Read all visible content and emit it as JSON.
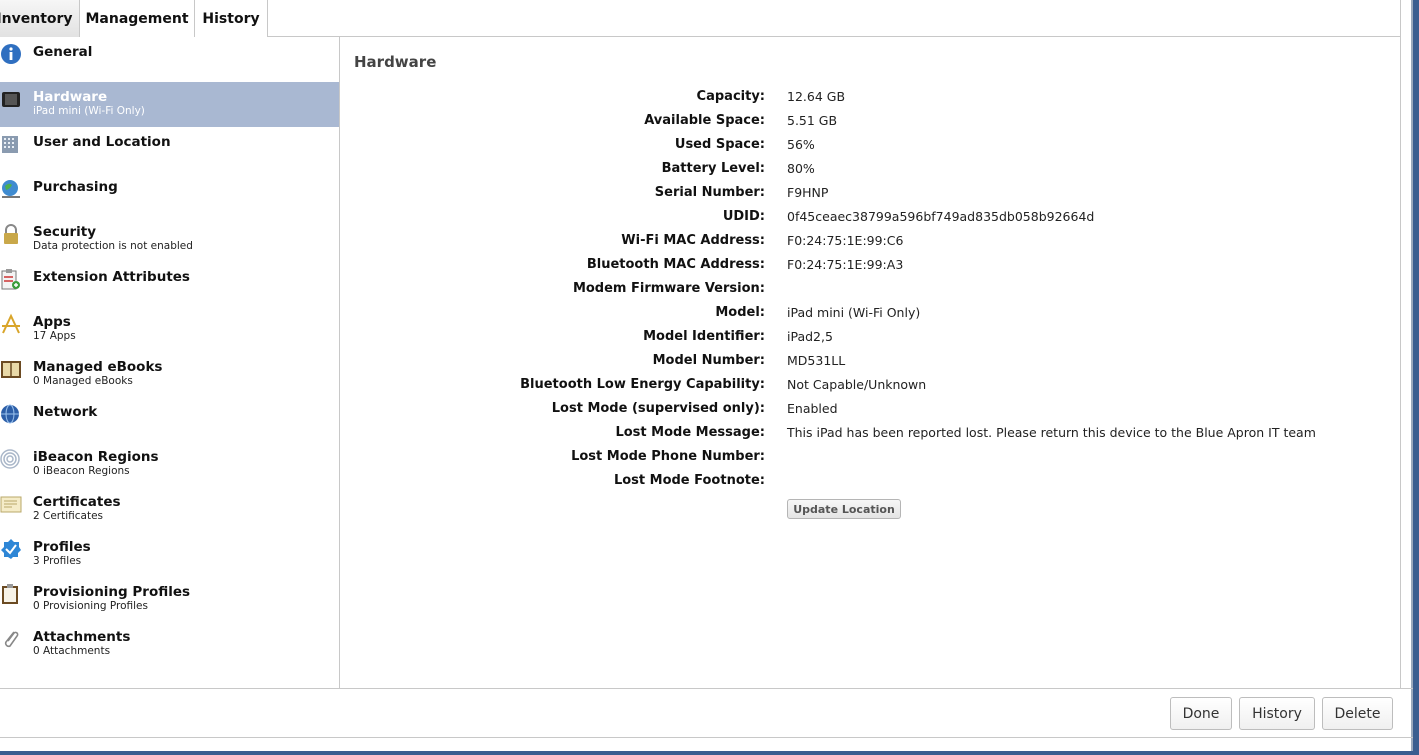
{
  "tabs": [
    {
      "label": "Inventory"
    },
    {
      "label": "Management"
    },
    {
      "label": "History"
    }
  ],
  "sidebar": {
    "items": [
      {
        "title": "General",
        "sub": "",
        "icon": "info-icon"
      },
      {
        "title": "Hardware",
        "sub": "iPad mini (Wi-Fi Only)",
        "icon": "ipad-icon"
      },
      {
        "title": "User and Location",
        "sub": "",
        "icon": "building-icon"
      },
      {
        "title": "Purchasing",
        "sub": "",
        "icon": "globe-icon"
      },
      {
        "title": "Security",
        "sub": "Data protection is not enabled",
        "icon": "lock-icon"
      },
      {
        "title": "Extension Attributes",
        "sub": "",
        "icon": "clipboard-add-icon"
      },
      {
        "title": "Apps",
        "sub": "17 Apps",
        "icon": "app-store-icon"
      },
      {
        "title": "Managed eBooks",
        "sub": "0 Managed eBooks",
        "icon": "book-icon"
      },
      {
        "title": "Network",
        "sub": "",
        "icon": "network-globe-icon"
      },
      {
        "title": "iBeacon Regions",
        "sub": "0 iBeacon Regions",
        "icon": "beacon-icon"
      },
      {
        "title": "Certificates",
        "sub": "2 Certificates",
        "icon": "certificate-icon"
      },
      {
        "title": "Profiles",
        "sub": "3 Profiles",
        "icon": "badge-check-icon"
      },
      {
        "title": "Provisioning Profiles",
        "sub": "0 Provisioning Profiles",
        "icon": "provisioning-icon"
      },
      {
        "title": "Attachments",
        "sub": "0 Attachments",
        "icon": "paperclip-icon"
      }
    ]
  },
  "main": {
    "title": "Hardware",
    "rows": [
      {
        "label": "Capacity:",
        "value": "12.64 GB"
      },
      {
        "label": "Available Space:",
        "value": "5.51 GB"
      },
      {
        "label": "Used Space:",
        "value": "56%"
      },
      {
        "label": "Battery Level:",
        "value": "80%"
      },
      {
        "label": "Serial Number:",
        "value": "F9HNP"
      },
      {
        "label": "UDID:",
        "value": "0f45ceaec38799a596bf749ad835db058b92664d"
      },
      {
        "label": "Wi-Fi MAC Address:",
        "value": "F0:24:75:1E:99:C6"
      },
      {
        "label": "Bluetooth MAC Address:",
        "value": "F0:24:75:1E:99:A3"
      },
      {
        "label": "Modem Firmware Version:",
        "value": ""
      },
      {
        "label": "Model:",
        "value": "iPad mini (Wi-Fi Only)"
      },
      {
        "label": "Model Identifier:",
        "value": "iPad2,5"
      },
      {
        "label": "Model Number:",
        "value": "MD531LL"
      },
      {
        "label": "Bluetooth Low Energy Capability:",
        "value": "Not Capable/Unknown"
      },
      {
        "label": "Lost Mode (supervised only):",
        "value": "Enabled"
      },
      {
        "label": "Lost Mode Message:",
        "value": "This iPad has been reported lost. Please return this device to the Blue Apron IT team"
      },
      {
        "label": "Lost Mode Phone Number:",
        "value": ""
      },
      {
        "label": "Lost Mode Footnote:",
        "value": ""
      }
    ],
    "update_label": "Update Location"
  },
  "footer": {
    "done_label": "Done",
    "history_label": "History",
    "delete_label": "Delete"
  },
  "colors": {
    "selected_bg": "#a9b8d2",
    "desktop_bg": "#3a5d8f"
  }
}
